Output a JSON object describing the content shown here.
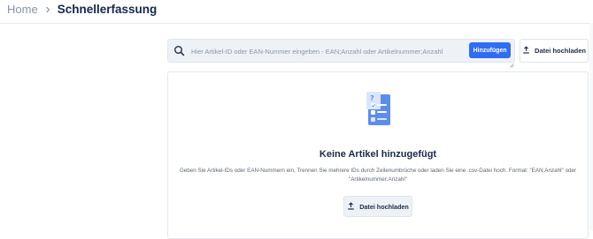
{
  "breadcrumb": {
    "home": "Home",
    "current": "Schnellerfassung"
  },
  "search": {
    "placeholder": "Hier Artikel-ID oder EAN-Nummer eingeben - EAN;Anzahl oder Artikelnummer;Anzahl",
    "value": ""
  },
  "toolbar": {
    "add_label": "Hinzufügen",
    "upload_label": "Datei hochladen"
  },
  "empty_state": {
    "title": "Keine Artikel hinzugefügt",
    "description": "Geben Sie Artikel-IDs oder EAN-Nummern ein, Trennen Sie mehrere IDs durch Zeilenumbrüche oder laden Sie eine .csv-Datei hoch. Format: \"EAN;Anzahl\" oder \"Artikelnummer;Anzahl\"",
    "upload_label": "Datei hochladen"
  },
  "icons": {
    "breadcrumb_separator": "chevron-right-icon",
    "search": "search-icon",
    "upload": "upload-icon",
    "empty": "clipboard-document-icon"
  },
  "colors": {
    "accent": "#2f6df2",
    "title": "#15274a",
    "muted": "#8a93a3",
    "doc_icon": "#5b8def"
  }
}
